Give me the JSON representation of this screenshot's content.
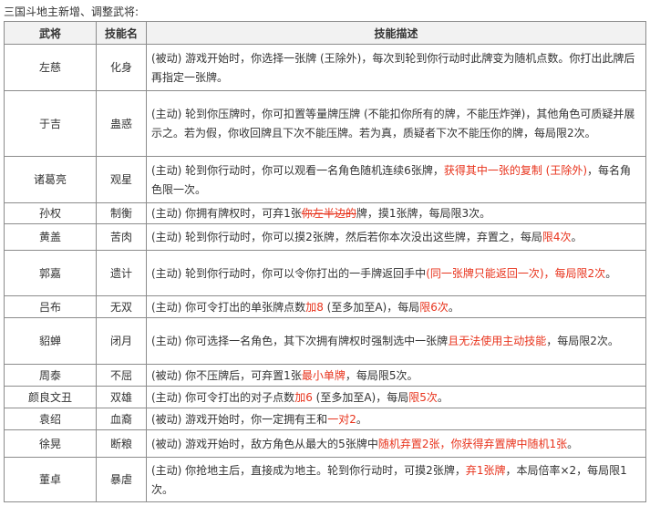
{
  "heading": "三国斗地主新增、调整武将:",
  "colors": {
    "highlight": "#e8331c",
    "border": "#8c8c8c",
    "header_bg": "#f2f2f2"
  },
  "columns": {
    "general": "武将",
    "skill": "技能名",
    "description": "技能描述"
  },
  "rows": [
    {
      "general": "左慈",
      "skill": "化身",
      "h": 51,
      "desc": [
        {
          "t": "(被动) 游戏开始时，你选择一张牌 (王除外)，每次到轮到你行动时此牌变为随机点数。你打出此牌后再指定一张牌。"
        }
      ]
    },
    {
      "general": "于吉",
      "skill": "蛊惑",
      "h": 72,
      "desc": [
        {
          "t": "(主动) 轮到你压牌时，你可扣置等量牌压牌 (不能扣你所有的牌，不能压炸弹)，其他角色可质疑并展示之。若为假，你收回牌且下次不能压牌。若为真，质疑者下次不能压你的牌，每局限2次。"
        }
      ]
    },
    {
      "general": "诸葛亮",
      "skill": "观星",
      "h": 51,
      "desc": [
        {
          "t": "(主动) 轮到你行动时，你可以观看一名角色随机连续6张牌，"
        },
        {
          "t": "获得其中一张的复制 (王除外)",
          "c": "red"
        },
        {
          "t": "，每名角色限一次。"
        }
      ]
    },
    {
      "general": "孙权",
      "skill": "制衡",
      "h": 23,
      "desc": [
        {
          "t": "(主动) 你拥有牌权时，可弃1张"
        },
        {
          "t": "你左半边的",
          "c": "red",
          "s": true
        },
        {
          "t": "牌，摸1张牌，每局限3次。"
        }
      ]
    },
    {
      "general": "黄盖",
      "skill": "苦肉",
      "h": 29,
      "desc": [
        {
          "t": "(主动) 轮到你行动时，你可以摸2张牌，然后若你本次没出这些牌，弃置之，每局"
        },
        {
          "t": "限4次",
          "c": "red"
        },
        {
          "t": "。"
        }
      ]
    },
    {
      "general": "郭嘉",
      "skill": "遗计",
      "h": 50,
      "desc": [
        {
          "t": "(主动) 轮到你行动时，你可以令你打出的一手牌返回手中"
        },
        {
          "t": "(同一张牌只能返回一次)，每局限2次",
          "c": "red"
        },
        {
          "t": "。"
        }
      ]
    },
    {
      "general": "吕布",
      "skill": "无双",
      "h": 24,
      "desc": [
        {
          "t": "(主动) 你可令打出的单张牌点数"
        },
        {
          "t": "加8",
          "c": "red"
        },
        {
          "t": " (至多加至A)，每局"
        },
        {
          "t": "限6次",
          "c": "red"
        },
        {
          "t": "。"
        }
      ]
    },
    {
      "general": "貂蝉",
      "skill": "闭月",
      "h": 51,
      "desc": [
        {
          "t": "(主动) 你可选择一名角色，其下次拥有牌权时强制选中一张牌"
        },
        {
          "t": "且无法使用主动技能",
          "c": "red"
        },
        {
          "t": "，每局限2次。"
        }
      ]
    },
    {
      "general": "周泰",
      "skill": "不屈",
      "h": 24,
      "desc": [
        {
          "t": "(被动) 你不压牌后，可弃置1张"
        },
        {
          "t": "最小单牌",
          "c": "red"
        },
        {
          "t": "，每局限5次。"
        }
      ]
    },
    {
      "general": "颜良文丑",
      "skill": "双雄",
      "h": 24,
      "desc": [
        {
          "t": "(主动) 你可令打出的对子点数"
        },
        {
          "t": "加6",
          "c": "red"
        },
        {
          "t": " (至多加至A)，每局"
        },
        {
          "t": "限5次",
          "c": "red"
        },
        {
          "t": "。"
        }
      ]
    },
    {
      "general": "袁绍",
      "skill": "血裔",
      "h": 24,
      "desc": [
        {
          "t": "(被动) 游戏开始时，你一定拥有王和"
        },
        {
          "t": "一对2",
          "c": "red"
        },
        {
          "t": "。"
        }
      ]
    },
    {
      "general": "徐晃",
      "skill": "断粮",
      "h": 30,
      "desc": [
        {
          "t": "(被动) 游戏开始时，敌方角色从最大的5张牌中"
        },
        {
          "t": "随机弃置2张，你获得弃置牌中随机1张",
          "c": "red"
        },
        {
          "t": "。"
        }
      ]
    },
    {
      "general": "董卓",
      "skill": "暴虐",
      "h": 49,
      "desc": [
        {
          "t": "(主动) 你抢地主后，直接成为地主。轮到你行动时，可摸2张牌，"
        },
        {
          "t": "弃1张牌",
          "c": "red"
        },
        {
          "t": "，本局倍率×2，每局限1次。"
        }
      ]
    }
  ]
}
